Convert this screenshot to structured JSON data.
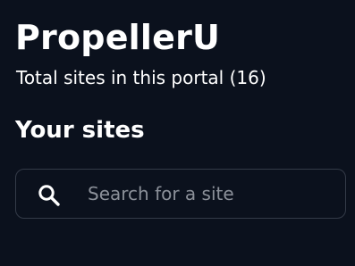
{
  "header": {
    "title": "PropellerU",
    "subtitle": "Total sites in this portal (16)"
  },
  "sites_section": {
    "heading": "Your sites"
  },
  "search": {
    "icon": "search-icon",
    "placeholder": "Search for a site",
    "value": ""
  },
  "colors": {
    "background": "#0b111d",
    "text": "#ffffff",
    "placeholder": "#8b9099",
    "border": "#343b48"
  }
}
